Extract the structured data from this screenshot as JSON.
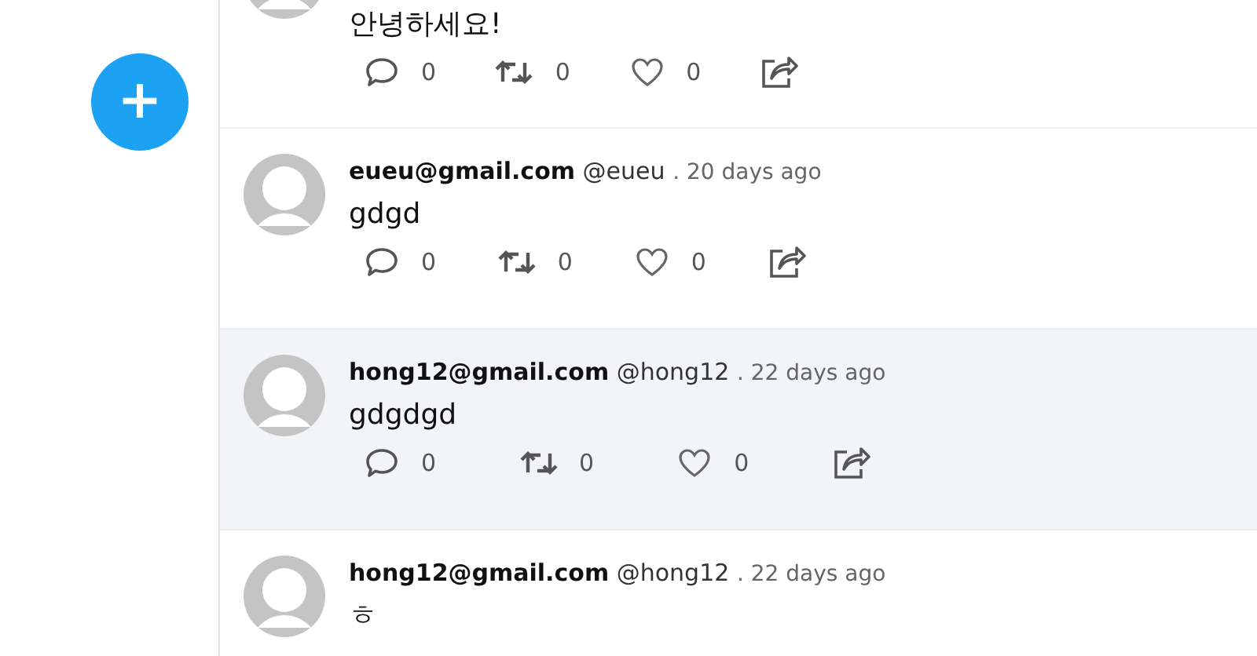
{
  "compose_button": {
    "label": "+"
  },
  "posts": [
    {
      "text": "안녕하세요!",
      "highlighted": false,
      "actions": {
        "comments": "0",
        "retweets": "0",
        "likes": "0"
      }
    },
    {
      "author": {
        "email": "eueu@gmail.com",
        "handle": "@eueu",
        "time": ". 20 days ago"
      },
      "text": "gdgd",
      "highlighted": false,
      "actions": {
        "comments": "0",
        "retweets": "0",
        "likes": "0"
      }
    },
    {
      "author": {
        "email": "hong12@gmail.com",
        "handle": "@hong12",
        "time": ". 22 days ago"
      },
      "text": "gdgdgd",
      "highlighted": true,
      "actions": {
        "comments": "0",
        "retweets": "0",
        "likes": "0"
      }
    },
    {
      "author": {
        "email": "hong12@gmail.com",
        "handle": "@hong12",
        "time": ". 22 days ago"
      },
      "text": "ㅎ",
      "highlighted": false
    }
  ]
}
